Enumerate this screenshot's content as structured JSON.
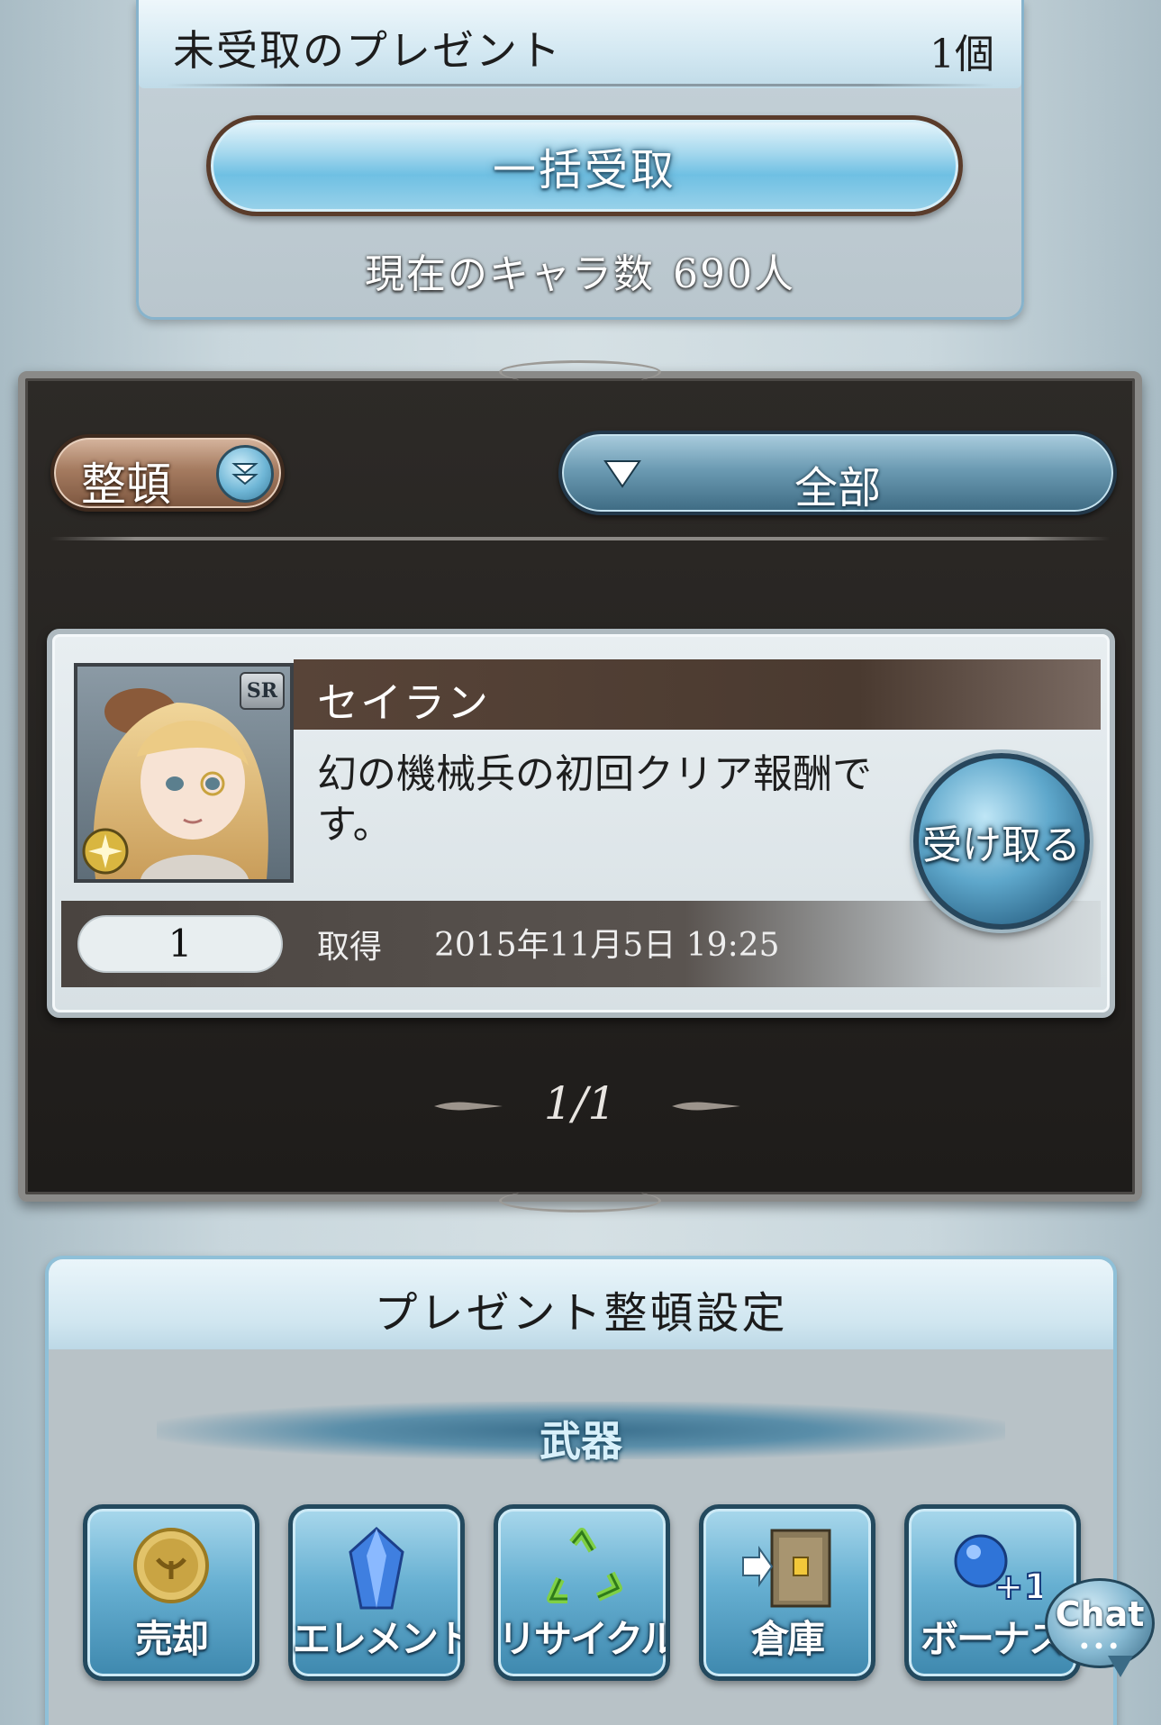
{
  "summary": {
    "label": "未受取のプレゼント",
    "count": "1個",
    "bulk_receive_label": "一括受取",
    "chara_count_label": "現在のキャラ数",
    "chara_count_value": "690人"
  },
  "list": {
    "sort_label": "整頓",
    "filter_value": "全部",
    "items": [
      {
        "name": "セイラン",
        "rarity": "SR",
        "description": "幻の機械兵の初回クリア報酬です。",
        "quantity": "1",
        "acquired_label": "取得",
        "acquired_date": "2015年11月5日 19:25",
        "receive_label": "受け取る"
      }
    ],
    "pagination": "1/1"
  },
  "settings": {
    "title": "プレゼント整頓設定",
    "category": "武器",
    "actions": [
      {
        "label": "売却",
        "icon": "coin-icon"
      },
      {
        "label": "エレメント",
        "icon": "crystal-icon"
      },
      {
        "label": "リサイクル",
        "icon": "recycle-icon"
      },
      {
        "label": "倉庫",
        "icon": "storage-icon"
      },
      {
        "label": "ボーナス",
        "icon": "bonus-plus-one-icon"
      }
    ]
  },
  "chat": {
    "label": "Chat",
    "dots": "•••"
  },
  "colors": {
    "panel_dark": "#2d2a27",
    "button_blue": "#67b0d2",
    "sort_brown": "#a57b60"
  }
}
